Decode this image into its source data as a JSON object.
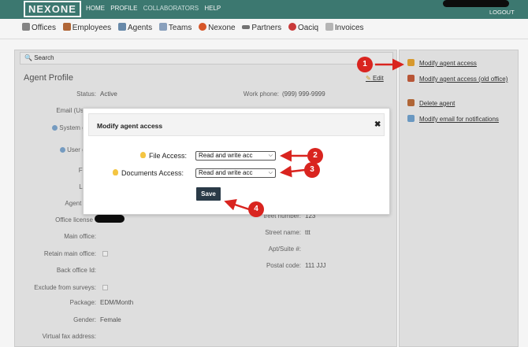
{
  "topbar": {
    "logo": "NEXONE",
    "nav": [
      "HOME",
      "PROFILE",
      "COLLABORATORS",
      "HELP"
    ],
    "logout": "LOGOUT"
  },
  "subnav": [
    {
      "label": "Offices",
      "icon": "building-icon",
      "color": "#8a8a8a"
    },
    {
      "label": "Employees",
      "icon": "person-icon",
      "color": "#b86b3a"
    },
    {
      "label": "Agents",
      "icon": "agents-icon",
      "color": "#6c8fb0"
    },
    {
      "label": "Teams",
      "icon": "teams-icon",
      "color": "#8fa7c4"
    },
    {
      "label": "Nexone",
      "icon": "nexone-icon",
      "color": "#e05a2a"
    },
    {
      "label": "Partners",
      "icon": "partners-icon",
      "color": "#777777"
    },
    {
      "label": "Oaciq",
      "icon": "oaciq-icon",
      "color": "#d23c3c"
    },
    {
      "label": "Invoices",
      "icon": "invoice-icon",
      "color": "#9a9a9a"
    }
  ],
  "search": {
    "label": "Search"
  },
  "profile": {
    "title": "Agent Profile",
    "edit": "Edit",
    "left_fields": [
      {
        "label": "Status:",
        "value": "Active"
      },
      {
        "label": "Email (Userna",
        "value": ""
      },
      {
        "label": "System gene",
        "label2": "er",
        "value": ""
      },
      {
        "label": "User gene",
        "label2": "er",
        "value": ""
      },
      {
        "label": "First n",
        "value": ""
      },
      {
        "label": "Last n",
        "value": ""
      },
      {
        "label": "Agent licen",
        "value": ""
      },
      {
        "label": "Office license",
        "value": ""
      },
      {
        "label": "Main office:",
        "value": ""
      },
      {
        "label": "Retain main office:",
        "value": ""
      },
      {
        "label": "Back office Id:",
        "value": ""
      },
      {
        "label": "Exclude from surveys:",
        "value": ""
      },
      {
        "label": "Package:",
        "value": "EDM/Month"
      },
      {
        "label": "Gender:",
        "value": "Female"
      },
      {
        "label": "Virtual fax address:",
        "value": ""
      }
    ],
    "right_fields": [
      {
        "label": "Work phone:",
        "value": "(999) 999-9999"
      },
      {
        "label": "treet number:",
        "value": "123"
      },
      {
        "label": "Street name:",
        "value": "ttt"
      },
      {
        "label": "Apt/Suite #:",
        "value": ""
      },
      {
        "label": "Postal code:",
        "value": "111 JJJ"
      }
    ]
  },
  "sidebar": {
    "links": [
      {
        "label": "Modify agent access",
        "icon": "lock-icon",
        "color": "#e0a030"
      },
      {
        "label": "Modify agent access (old office)",
        "icon": "user-lock-icon",
        "color": "#c05a3a"
      },
      {
        "label": "Delete agent",
        "icon": "user-delete-icon",
        "color": "#b86b3a"
      },
      {
        "label": "Modify email for notifications",
        "icon": "mail-icon",
        "color": "#6f9fc9"
      }
    ]
  },
  "modal": {
    "title": "Modify agent access",
    "close": "✖",
    "file_access_label": "File Access:",
    "file_access_value": "Read and write acc",
    "documents_access_label": "Documents Access:",
    "documents_access_value": "Read and write acc",
    "save": "Save"
  },
  "annotations": [
    "1",
    "2",
    "3",
    "4"
  ],
  "colors": {
    "topbar": "#3f7d75",
    "annotation": "#d9241f",
    "save_button": "#2a3a47"
  }
}
